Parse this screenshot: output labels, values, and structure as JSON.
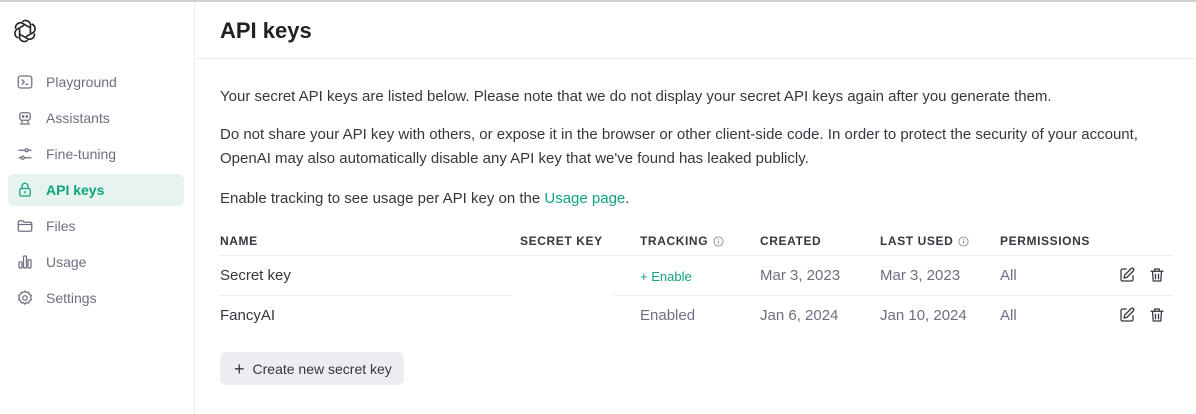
{
  "sidebar": {
    "logo_icon": "openai-logo-icon",
    "items": [
      {
        "label": "Playground",
        "icon": "terminal-icon",
        "active": false
      },
      {
        "label": "Assistants",
        "icon": "robot-icon",
        "active": false
      },
      {
        "label": "Fine-tuning",
        "icon": "sliders-icon",
        "active": false
      },
      {
        "label": "API keys",
        "icon": "lock-icon",
        "active": true
      },
      {
        "label": "Files",
        "icon": "folder-icon",
        "active": false
      },
      {
        "label": "Usage",
        "icon": "bar-chart-icon",
        "active": false
      },
      {
        "label": "Settings",
        "icon": "gear-icon",
        "active": false
      }
    ]
  },
  "header": {
    "title": "API keys"
  },
  "main": {
    "intro": "Your secret API keys are listed below. Please note that we do not display your secret API keys again after you generate them.",
    "warning": "Do not share your API key with others, or expose it in the browser or other client-side code. In order to protect the security of your account, OpenAI may also automatically disable any API key that we've found has leaked publicly.",
    "tracking_text_before": "Enable tracking to see usage per API key on the ",
    "tracking_link": "Usage page",
    "tracking_text_after": "."
  },
  "table": {
    "headers": {
      "name": "NAME",
      "secret_key": "SECRET KEY",
      "tracking": "TRACKING",
      "created": "CREATED",
      "last_used": "LAST USED",
      "permissions": "PERMISSIONS"
    },
    "rows": [
      {
        "name": "Secret key",
        "secret_key": "",
        "tracking": "+ Enable",
        "tracking_is_link": true,
        "created": "Mar 3, 2023",
        "last_used": "Mar 3, 2023",
        "permissions": "All"
      },
      {
        "name": "FancyAI",
        "secret_key": "",
        "tracking": "Enabled",
        "tracking_is_link": false,
        "created": "Jan 6, 2024",
        "last_used": "Jan 10, 2024",
        "permissions": "All"
      }
    ]
  },
  "create_button": {
    "label": "Create new secret key"
  },
  "colors": {
    "accent": "#10a37f",
    "active_bg": "#e6f3ee",
    "button_bg": "#ececf1"
  }
}
